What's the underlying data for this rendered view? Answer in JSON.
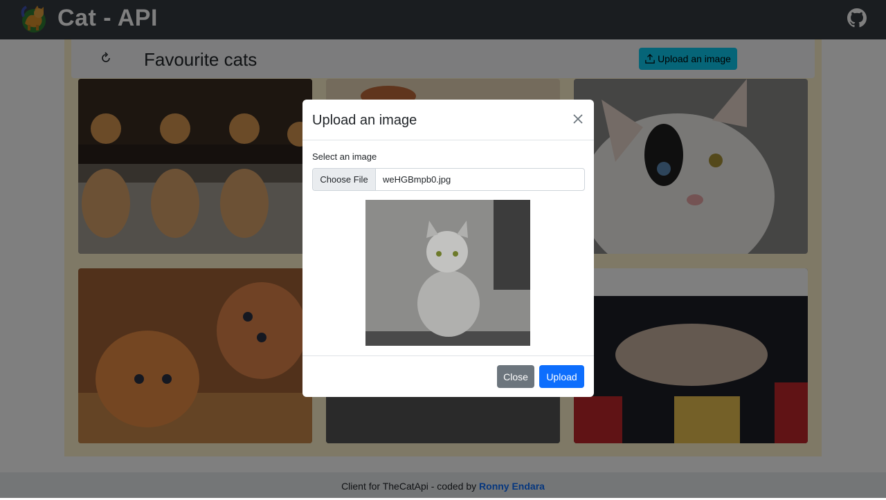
{
  "app": {
    "title": "Cat - API"
  },
  "toolbar": {
    "title": "Favourite cats",
    "upload_label": "Upload an image"
  },
  "gallery": {
    "cards": [
      {
        "alt": "Row of orange kittens on a wooden fence"
      },
      {
        "alt": "Cat photo"
      },
      {
        "alt": "White cat with black eye patch"
      },
      {
        "alt": "Two orange kittens"
      },
      {
        "alt": "Cat photo"
      },
      {
        "alt": "Two sleeping cats near rubik cubes"
      }
    ]
  },
  "modal": {
    "title": "Upload an image",
    "field_label": "Select an image",
    "choose_label": "Choose File",
    "file_name": "weHGBmpb0.jpg",
    "close_label": "Close",
    "upload_label": "Upload"
  },
  "footer": {
    "text": "Client for TheCatApi - coded by",
    "author": "Ronny Endara"
  }
}
